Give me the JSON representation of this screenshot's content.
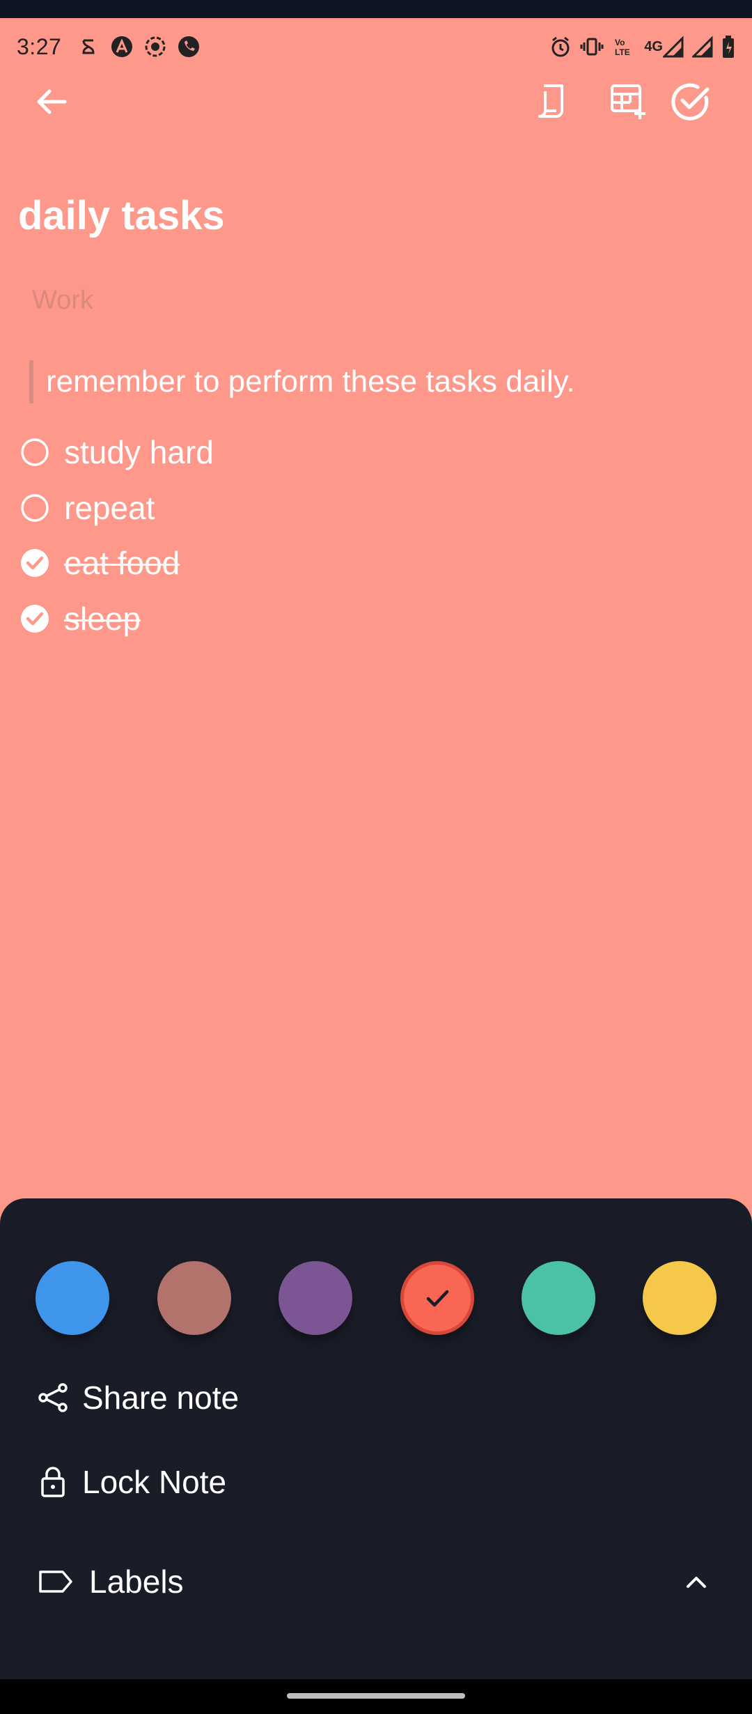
{
  "status_bar": {
    "time": "3:27",
    "network": "4G",
    "left_icons": [
      "ring-notification-icon",
      "arch-app-icon",
      "screen-record-icon",
      "phone-call-icon"
    ],
    "right_icons": [
      "alarm-icon",
      "vibrate-icon",
      "volte-icon",
      "signal-4g-icon",
      "signal-icon",
      "battery-icon"
    ]
  },
  "toolbar": {
    "back_icon": "arrow-left-icon",
    "actions": [
      "scroll-note-icon",
      "table-add-icon",
      "check-circle-icon"
    ]
  },
  "note": {
    "title": "daily tasks",
    "label": "Work",
    "quote": "remember to perform these tasks daily.",
    "tasks": [
      {
        "text": "study hard",
        "done": false
      },
      {
        "text": "repeat",
        "done": false
      },
      {
        "text": "eat food",
        "done": true
      },
      {
        "text": "sleep",
        "done": true
      }
    ]
  },
  "colors": {
    "background": "#fd988a",
    "sheet": "#1a1d28",
    "swatches": [
      "#3f95eb",
      "#b1736c",
      "#7c5694",
      "#fa6654",
      "#4bc2a8",
      "#f5c84a"
    ],
    "selected_swatch_index": 3
  },
  "sheet": {
    "share_label": "Share note",
    "lock_label": "Lock Note",
    "labels_label": "Labels"
  }
}
